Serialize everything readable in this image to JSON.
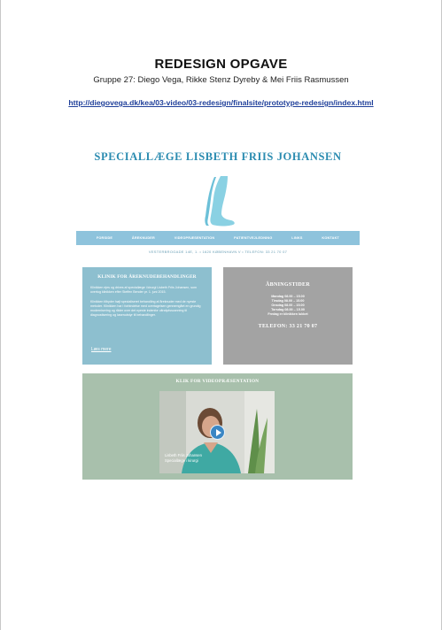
{
  "document": {
    "title": "REDESIGN OPGAVE",
    "subtitle": "Gruppe 27: Diego Vega, Rikke Stenz Dyreby & Mei Friis Rasmussen",
    "link": "http://diegovega.dk/kea/03-video/03-redesign/finalsite/prototype-redesign/index.html"
  },
  "site": {
    "title": "SPECIALLÆGE LISBETH FRIIS JOHANSEN",
    "nav": [
      "FORSIDE",
      "ÅREKNUDER",
      "VIDEOPRÆSENTATION",
      "PATIENTVEJLEDNING",
      "LINKS",
      "KONTAKT"
    ],
    "address": "VESTERBROGADE 14E, 1. • 1620 KØBENHAVN V • TELEFON: 33 21 70 07",
    "clinic": {
      "heading": "KLINIK FOR ÅREKNUDEBEHANDLINGER",
      "para1": "Klinikken ejes og drives af speciallæge i kirurgi Lisbeth Friis Johansen, som overtog klinikken efter Steffen Bender pr. 1. juni 2015.",
      "para2": "Klinikken tilbyder højt specialiseret behandling af åreknuder med de nyeste metoder. Klinikken har i forbindelse med overtagelsen gennemgået en grundig modernisering og råder over det nyeste indenfor ultralydsscanning til diagnostisering og laserudstyr til behandlinger.",
      "more": "Læs mere"
    },
    "hours": {
      "heading": "ÅBNINGSTIDER",
      "lines": [
        "Mandag 08.00 – 15.00",
        "Tirsdag 08.00 – 15.00",
        "Onsdag 08.00 – 15.00",
        "Torsdag 08.00 – 15.00",
        "Fredag er klinikken lukket"
      ],
      "phone": "TELEFON: 33 21 70 07"
    },
    "video": {
      "heading": "KLIK FOR VIDEOPRÆSENTATION",
      "caption_name": "Lisbeth Friis Johansen",
      "caption_role": "Speciallæge i kirurgi"
    }
  },
  "colors": {
    "brand_blue": "#2a8bb0",
    "nav_blue": "#8ec3dc",
    "clinic_card": "#8dbfcf",
    "hours_card": "#a3a3a3",
    "video_box": "#a8c0ac",
    "link_blue": "#1f3f9a"
  },
  "icons": [
    "leg-logo-icon",
    "play-icon"
  ]
}
